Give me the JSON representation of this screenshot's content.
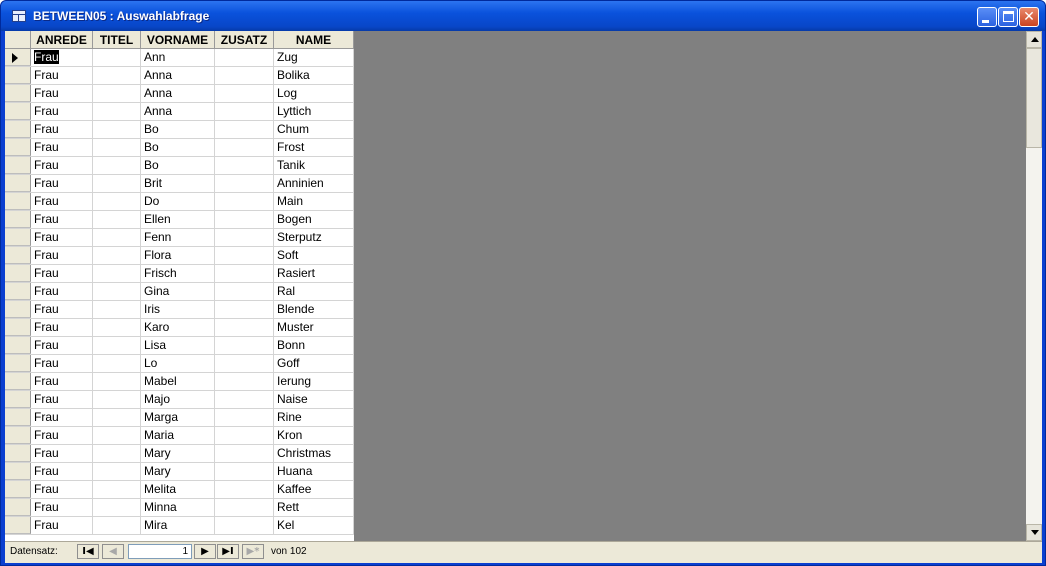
{
  "window": {
    "title": "BETWEEN05 : Auswahlabfrage",
    "minimize_glyph": "",
    "maximize_glyph": "",
    "close_glyph": "✕"
  },
  "columns": [
    "ANREDE",
    "TITEL",
    "VORNAME",
    "ZUSATZ",
    "NAME"
  ],
  "rows": [
    {
      "anrede": "Frau",
      "titel": "",
      "vorname": "Ann",
      "zusatz": "",
      "name": "Zug"
    },
    {
      "anrede": "Frau",
      "titel": "",
      "vorname": "Anna",
      "zusatz": "",
      "name": "Bolika"
    },
    {
      "anrede": "Frau",
      "titel": "",
      "vorname": "Anna",
      "zusatz": "",
      "name": "Log"
    },
    {
      "anrede": "Frau",
      "titel": "",
      "vorname": "Anna",
      "zusatz": "",
      "name": "Lyttich"
    },
    {
      "anrede": "Frau",
      "titel": "",
      "vorname": "Bo",
      "zusatz": "",
      "name": "Chum"
    },
    {
      "anrede": "Frau",
      "titel": "",
      "vorname": "Bo",
      "zusatz": "",
      "name": "Frost"
    },
    {
      "anrede": "Frau",
      "titel": "",
      "vorname": "Bo",
      "zusatz": "",
      "name": "Tanik"
    },
    {
      "anrede": "Frau",
      "titel": "",
      "vorname": "Brit",
      "zusatz": "",
      "name": "Anninien"
    },
    {
      "anrede": "Frau",
      "titel": "",
      "vorname": "Do",
      "zusatz": "",
      "name": "Main"
    },
    {
      "anrede": "Frau",
      "titel": "",
      "vorname": "Ellen",
      "zusatz": "",
      "name": "Bogen"
    },
    {
      "anrede": "Frau",
      "titel": "",
      "vorname": "Fenn",
      "zusatz": "",
      "name": "Sterputz"
    },
    {
      "anrede": "Frau",
      "titel": "",
      "vorname": "Flora",
      "zusatz": "",
      "name": "Soft"
    },
    {
      "anrede": "Frau",
      "titel": "",
      "vorname": "Frisch",
      "zusatz": "",
      "name": "Rasiert"
    },
    {
      "anrede": "Frau",
      "titel": "",
      "vorname": "Gina",
      "zusatz": "",
      "name": "Ral"
    },
    {
      "anrede": "Frau",
      "titel": "",
      "vorname": "Iris",
      "zusatz": "",
      "name": "Blende"
    },
    {
      "anrede": "Frau",
      "titel": "",
      "vorname": "Karo",
      "zusatz": "",
      "name": "Muster"
    },
    {
      "anrede": "Frau",
      "titel": "",
      "vorname": "Lisa",
      "zusatz": "",
      "name": "Bonn"
    },
    {
      "anrede": "Frau",
      "titel": "",
      "vorname": "Lo",
      "zusatz": "",
      "name": "Goff"
    },
    {
      "anrede": "Frau",
      "titel": "",
      "vorname": "Mabel",
      "zusatz": "",
      "name": "Ierung"
    },
    {
      "anrede": "Frau",
      "titel": "",
      "vorname": "Majo",
      "zusatz": "",
      "name": "Naise"
    },
    {
      "anrede": "Frau",
      "titel": "",
      "vorname": "Marga",
      "zusatz": "",
      "name": "Rine"
    },
    {
      "anrede": "Frau",
      "titel": "",
      "vorname": "Maria",
      "zusatz": "",
      "name": "Kron"
    },
    {
      "anrede": "Frau",
      "titel": "",
      "vorname": "Mary",
      "zusatz": "",
      "name": "Christmas"
    },
    {
      "anrede": "Frau",
      "titel": "",
      "vorname": "Mary",
      "zusatz": "",
      "name": "Huana"
    },
    {
      "anrede": "Frau",
      "titel": "",
      "vorname": "Melita",
      "zusatz": "",
      "name": "Kaffee"
    },
    {
      "anrede": "Frau",
      "titel": "",
      "vorname": "Minna",
      "zusatz": "",
      "name": "Rett"
    },
    {
      "anrede": "Frau",
      "titel": "",
      "vorname": "Mira",
      "zusatz": "",
      "name": "Kel"
    }
  ],
  "navigator": {
    "label": "Datensatz:",
    "current_record": "1",
    "total_text": "von 102",
    "first_glyph": "I◀",
    "prev_glyph": "◀",
    "next_glyph": "▶",
    "last_glyph": "▶I",
    "new_glyph": "▶*"
  },
  "colors": {
    "titlebar": "#0a52dc",
    "workspace": "#808080",
    "chrome": "#ece9d8",
    "close_button": "#c9431f"
  },
  "icons": {
    "app": "datasheet-icon",
    "current_row": "current-record-arrow-icon"
  }
}
